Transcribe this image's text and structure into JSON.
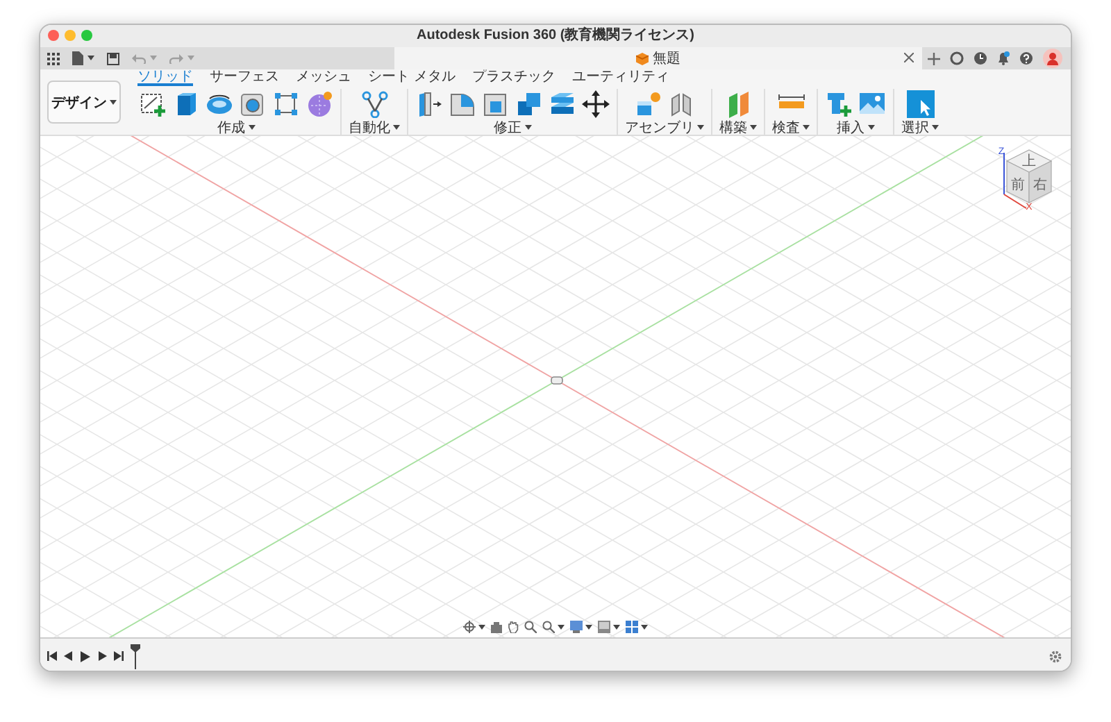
{
  "window": {
    "title": "Autodesk Fusion 360 (教育機関ライセンス)"
  },
  "toolbar": {
    "undo": {
      "disabled": true
    },
    "redo": {
      "disabled": true
    }
  },
  "document_tab": {
    "label": "無題"
  },
  "workspace": {
    "label": "デザイン"
  },
  "ribbon_tabs": [
    {
      "label": "ソリッド",
      "selected": true
    },
    {
      "label": "サーフェス",
      "selected": false
    },
    {
      "label": "メッシュ",
      "selected": false
    },
    {
      "label": "シート メタル",
      "selected": false
    },
    {
      "label": "プラスチック",
      "selected": false
    },
    {
      "label": "ユーティリティ",
      "selected": false
    }
  ],
  "tool_groups": [
    {
      "label": "作成"
    },
    {
      "label": "自動化"
    },
    {
      "label": "修正"
    },
    {
      "label": "アセンブリ"
    },
    {
      "label": "構築"
    },
    {
      "label": "検査"
    },
    {
      "label": "挿入"
    },
    {
      "label": "選択"
    }
  ],
  "viewcube": {
    "faces": [
      "上",
      "前",
      "右"
    ],
    "axes": [
      "Z",
      "X"
    ]
  }
}
